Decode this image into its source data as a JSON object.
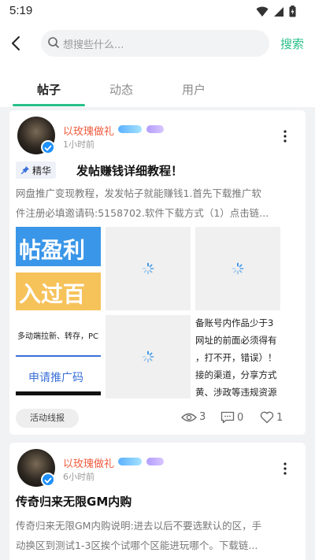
{
  "status": {
    "time": "5:19"
  },
  "search": {
    "placeholder": "想搜些什么...",
    "button": "搜索"
  },
  "tabs": [
    {
      "label": "帖子",
      "active": true
    },
    {
      "label": "动态",
      "active": false
    },
    {
      "label": "用户",
      "active": false
    }
  ],
  "posts": [
    {
      "username": "以玫瑰做礼",
      "time": "1小时前",
      "tag": "精华",
      "title": "发帖赚钱详细教程！",
      "body_line1": "网盘推广变现教程，发发帖子就能赚钱1.首先下载推广软",
      "body_line2": "件注册必填邀请码:5158702.软件下载方式（1）点击链...",
      "image1": {
        "line1": "帖盈利",
        "line2": "入过百",
        "line3": "多动端拉新、转存，PC",
        "line4": "申请推广码"
      },
      "image4": {
        "line1": "备账号内作品少于3",
        "line2": "网址的前面必须得有",
        "line3": "，打不开，错误）！",
        "line4": "接的渠道，分享方式",
        "line5": "黄、涉政等违规资源"
      },
      "activity": "活动线报",
      "views": "3",
      "comments": "0",
      "likes": "1"
    },
    {
      "username": "以玫瑰做礼",
      "time": "6小时前",
      "title": "传奇归来无限GM内购",
      "body_line1": "传奇归来无限GM内购说明:进去以后不要选默认的区，手",
      "body_line2": "动换区到测试1-3区挨个试哪个区能进玩哪个。下载链..."
    }
  ],
  "colors": {
    "accent": "#29c08a",
    "username": "#f05a3c",
    "verify": "#1e90ff"
  }
}
